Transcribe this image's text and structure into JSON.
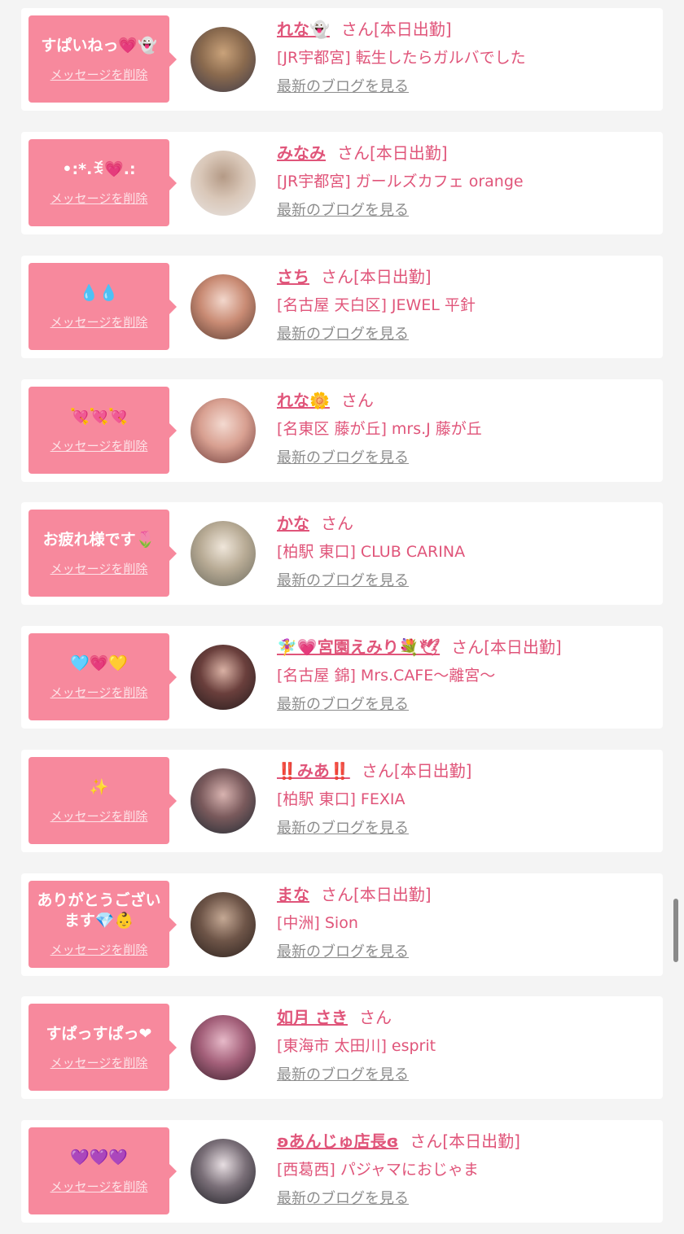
{
  "delete_label": "メッセージを削除",
  "blog_label": "最新のブログを見る",
  "honorific": "さん",
  "colors": {
    "bubble": "#f7899d",
    "accent": "#e0557a",
    "link_gray": "#8c8c8c"
  },
  "items": [
    {
      "message": "すぱいねっ💗👻",
      "name": "れな👻",
      "status": "[本日出勤]",
      "shop": "[JR宇都宮] 転生したらガルバでした",
      "avatar_colors": [
        "#3d3a4a",
        "#8a6a4e",
        "#c9a27a"
      ]
    },
    {
      "message": "•:*.ꉂ💗.:",
      "name": "みなみ",
      "status": "[本日出勤]",
      "shop": "[JR宇都宮] ガールズカフェ orange",
      "avatar_colors": [
        "#e8e4e2",
        "#d9c7b8",
        "#b49a86"
      ]
    },
    {
      "message": "💧💧",
      "name": "さち",
      "status": "[本日出勤]",
      "shop": "[名古屋 天白区] JEWEL 平針",
      "avatar_colors": [
        "#5b3d33",
        "#c98b74",
        "#f2d7cc"
      ]
    },
    {
      "message": "💘💘💘",
      "name": "れな🌼",
      "status": "",
      "shop": "[名東区 藤が丘] mrs.J 藤が丘",
      "avatar_colors": [
        "#6e3c3a",
        "#d8a091",
        "#f3d9d0"
      ]
    },
    {
      "message": "お疲れ様です🌷",
      "name": "かな",
      "status": "",
      "shop": "[柏駅 東口] CLUB CARINA",
      "avatar_colors": [
        "#6b6a5e",
        "#b8ab95",
        "#efe6da"
      ]
    },
    {
      "message": "🩵💗💛",
      "name": "🧚‍♀️💗宮園えみり💐🕊",
      "status": "[本日出勤]",
      "shop": "[名古屋 錦] Mrs.CAFE〜離宮〜",
      "avatar_colors": [
        "#231b1c",
        "#6a3f3c",
        "#d9b1a4"
      ]
    },
    {
      "message": "✨",
      "name": "‼️みあ‼️",
      "status": "[本日出勤]",
      "shop": "[柏駅 東口] FEXIA",
      "avatar_colors": [
        "#1f2a33",
        "#7a5a5c",
        "#d8b3b0"
      ]
    },
    {
      "message": "ありがとうございます💎👶",
      "name": "まな",
      "status": "[本日出勤]",
      "shop": "[中洲] Sion",
      "avatar_colors": [
        "#2a201d",
        "#6e5548",
        "#c4a894"
      ]
    },
    {
      "message": "すぱっすぱっ❤",
      "name": "如月 さき",
      "status": "",
      "shop": "[東海市 太田川] esprit",
      "avatar_colors": [
        "#3a1f2b",
        "#a4607a",
        "#e6b9c8"
      ]
    },
    {
      "message": "💜💜💜",
      "name": "ʚあんじゅ店長ɞ",
      "status": "[本日出勤]",
      "shop": "[西葛西] パジャマにおじゃま",
      "avatar_colors": [
        "#1e1e24",
        "#7a6f78",
        "#e7dee2"
      ]
    }
  ]
}
